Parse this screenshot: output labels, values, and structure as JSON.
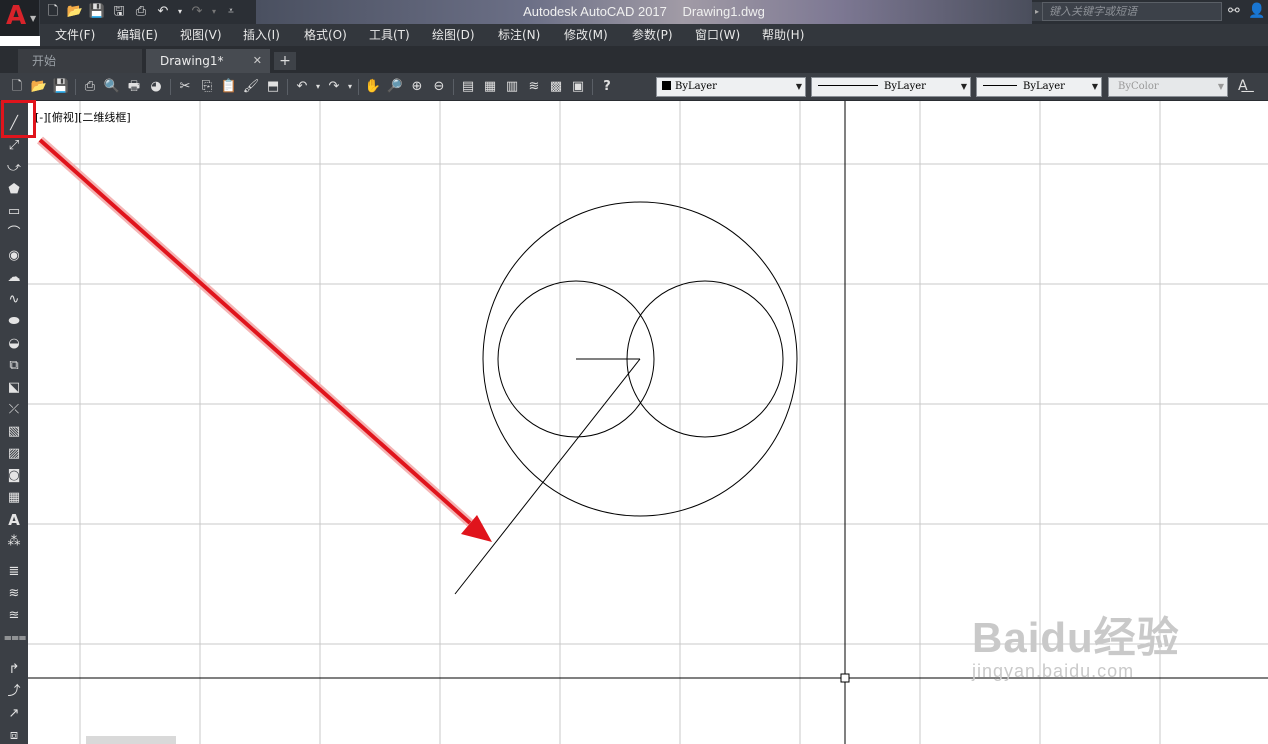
{
  "titlebar": {
    "app_name": "Autodesk AutoCAD 2017",
    "file_name": "Drawing1.dwg",
    "search_placeholder": "键入关键字或短语",
    "logo_letter": "A"
  },
  "menu": [
    "文件(F)",
    "编辑(E)",
    "视图(V)",
    "插入(I)",
    "格式(O)",
    "工具(T)",
    "绘图(D)",
    "标注(N)",
    "修改(M)",
    "参数(P)",
    "窗口(W)",
    "帮助(H)"
  ],
  "tabs": {
    "start": "开始",
    "drawing": "Drawing1*"
  },
  "properties": {
    "color": "ByLayer",
    "linetype": "ByLayer",
    "lineweight": "ByLayer",
    "plotstyle": "ByColor"
  },
  "viewport_label": "[-][俯视][二维线框]",
  "watermark": {
    "main": "Baidu经验",
    "sub": "jingyan.baidu.com"
  },
  "left_tools": [
    "line-icon",
    "construction-line-icon",
    "polyline-icon",
    "polygon-icon",
    "rectangle-icon",
    "arc-icon",
    "circle-icon",
    "revision-cloud-icon",
    "spline-icon",
    "ellipse-icon",
    "ellipse-arc-icon",
    "insert-block-icon",
    "make-block-icon",
    "point-icon",
    "hatch-icon",
    "gradient-icon",
    "region-icon",
    "table-icon",
    "mtext-icon",
    "add-selected-icon"
  ],
  "colors": {
    "highlight": "#e0141c",
    "arrow": "#e0141c",
    "drawing": "#000000",
    "grid": "#c8c8c8"
  }
}
